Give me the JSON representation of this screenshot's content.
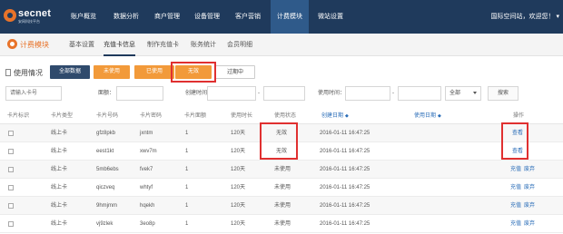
{
  "brand": {
    "name": "secnet",
    "tagline": "安网科技平台"
  },
  "nav": {
    "items": [
      "账户概览",
      "数据分析",
      "商户管理",
      "设备管理",
      "客户营销",
      "计费模块",
      "微站设置"
    ],
    "active": "计费模块",
    "user": "国际空间站，欢迎您！"
  },
  "subnav": {
    "title": "计费模块",
    "tabs": [
      "基本设置",
      "充值卡信息",
      "制作充值卡",
      "账务统计",
      "会员明细"
    ],
    "active": "充值卡信息"
  },
  "usage": {
    "label": "使用情况",
    "buttons": [
      "全部数据",
      "未使用",
      "已使用",
      "无效",
      "过期中"
    ],
    "active": "无效"
  },
  "search": {
    "card_placeholder": "请输入卡号",
    "face_label": "面额：",
    "create_label": "创建时间：",
    "use_label": "使用时间：",
    "select_value": "全部",
    "button": "搜索"
  },
  "table": {
    "headers": [
      "卡片标识",
      "卡片类型",
      "卡片号码",
      "卡片密码",
      "卡片面额",
      "使用时长",
      "使用状态",
      "创建日期",
      "使用日期",
      "操作"
    ],
    "rows": [
      {
        "type": "线上卡",
        "number": "gfz8pkb",
        "password": "jxntm",
        "face": "1",
        "duration": "120天",
        "status": "无效",
        "created": "2016-01-11 16:47:25",
        "used": "",
        "ops": [
          "查看"
        ]
      },
      {
        "type": "线上卡",
        "number": "eest1kt",
        "password": "xwv7m",
        "face": "1",
        "duration": "120天",
        "status": "无效",
        "created": "2016-01-11 16:47:25",
        "used": "",
        "ops": [
          "查看"
        ]
      },
      {
        "type": "线上卡",
        "number": "5mb6ebs",
        "password": "fvek7",
        "face": "1",
        "duration": "120天",
        "status": "未使用",
        "created": "2016-01-11 16:47:25",
        "used": "",
        "ops": [
          "充值",
          "废弃"
        ]
      },
      {
        "type": "线上卡",
        "number": "qiczveq",
        "password": "whtyf",
        "face": "1",
        "duration": "120天",
        "status": "未使用",
        "created": "2016-01-11 16:47:25",
        "used": "",
        "ops": [
          "充值",
          "废弃"
        ]
      },
      {
        "type": "线上卡",
        "number": "9hmjmm",
        "password": "hqekh",
        "face": "1",
        "duration": "120天",
        "status": "未使用",
        "created": "2016-01-11 16:47:25",
        "used": "",
        "ops": [
          "充值",
          "废弃"
        ]
      },
      {
        "type": "线上卡",
        "number": "vj9zlek",
        "password": "3eo8p",
        "face": "1",
        "duration": "120天",
        "status": "未使用",
        "created": "2016-01-11 16:47:25",
        "used": "",
        "ops": [
          "充值",
          "废弃"
        ]
      }
    ]
  },
  "colors": {
    "nav_bg": "#1f3a5c",
    "accent": "#f29a3a",
    "link": "#2a6db8",
    "highlight": "#e03030"
  }
}
